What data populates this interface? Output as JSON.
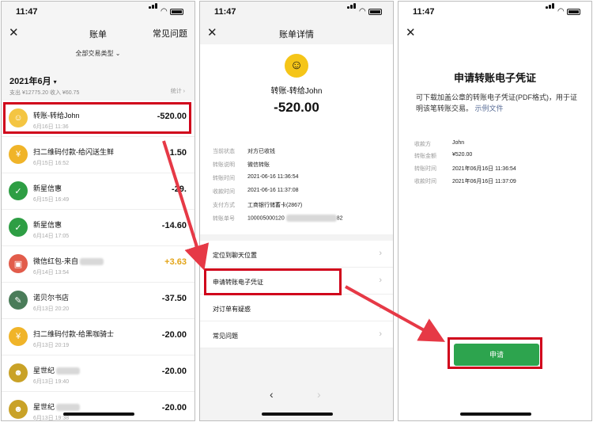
{
  "status": {
    "time": "11:47"
  },
  "screen1": {
    "close": "✕",
    "title": "账单",
    "help": "常见问题",
    "filter": "全部交易类型",
    "filter_caret": "⌄",
    "month": "2021年6月",
    "month_caret": "▾",
    "summary": "支出 ¥12775.20 收入 ¥60.75",
    "stats": "统计 ›",
    "rows": [
      {
        "name": "转账-转给John",
        "date": "6月16日 11:36",
        "amount": "-520.00",
        "avatar": "face",
        "color": "#f4c542"
      },
      {
        "name": "扫二维码付款-给闪送生鲜",
        "date": "6月15日 16:52",
        "amount": "1.50",
        "avatar": "coin",
        "color": "#f0b429"
      },
      {
        "name": "新星信惠",
        "date": "6月15日 16:49",
        "amount": "-29.",
        "avatar": "logo",
        "color": "#2e9e44"
      },
      {
        "name": "新星信惠",
        "date": "6月14日 17:05",
        "amount": "-14.60",
        "avatar": "logo",
        "color": "#2e9e44"
      },
      {
        "name": "微信红包-来自",
        "date": "6月14日 13:54",
        "amount": "+3.63",
        "avatar": "redpacket",
        "color": "#e25c4b",
        "blurred": true
      },
      {
        "name": "诺贝尔书店",
        "date": "6月13日 20:20",
        "amount": "-37.50",
        "avatar": "book",
        "color": "#4a7c59"
      },
      {
        "name": "扫二维码付款-给黑咖骑士",
        "date": "6月13日 20:19",
        "amount": "-20.00",
        "avatar": "coin",
        "color": "#f0b429"
      },
      {
        "name": "星世纪",
        "date": "6月13日 19:40",
        "amount": "-20.00",
        "avatar": "team",
        "color": "#c9a227",
        "blurred": true
      },
      {
        "name": "星世纪",
        "date": "6月13日 19:38",
        "amount": "-20.00",
        "avatar": "team",
        "color": "#c9a227",
        "blurred": true
      }
    ]
  },
  "screen2": {
    "close": "✕",
    "title": "账单详情",
    "who": "转账-转给John",
    "amount": "-520.00",
    "details": [
      {
        "k": "当前状态",
        "v": "对方已收钱"
      },
      {
        "k": "转账说明",
        "v": "微信转账"
      },
      {
        "k": "转账时间",
        "v": "2021-06-16 11:36:54"
      },
      {
        "k": "收款时间",
        "v": "2021-06-16 11:37:08"
      },
      {
        "k": "支付方式",
        "v": "工商银行储蓄卡(2867)"
      },
      {
        "k": "转账单号",
        "v": "100005000120",
        "v_tail": "82"
      }
    ],
    "menu": [
      {
        "label": "定位到聊天位置"
      },
      {
        "label": "申请转账电子凭证"
      },
      {
        "label": "对订单有疑惑"
      },
      {
        "label": "常见问题"
      }
    ],
    "chevron": "›",
    "prev": "‹",
    "next": "›"
  },
  "screen3": {
    "close": "✕",
    "title": "申请转账电子凭证",
    "desc_main": "可下载加盖公章的转账电子凭证(PDF格式)，用于证明该笔转账交易。",
    "desc_link": "示例文件",
    "details": [
      {
        "k": "收款方",
        "v": "John"
      },
      {
        "k": "转账金额",
        "v": "¥520.00"
      },
      {
        "k": "转账时间",
        "v": "2021年06月16日 11:36:54"
      },
      {
        "k": "收款时间",
        "v": "2021年06月16日 11:37:09"
      }
    ],
    "button": "申请"
  },
  "colors": {
    "highlight": "#d0021b",
    "accent_green": "#2da44e",
    "link": "#576b95"
  }
}
